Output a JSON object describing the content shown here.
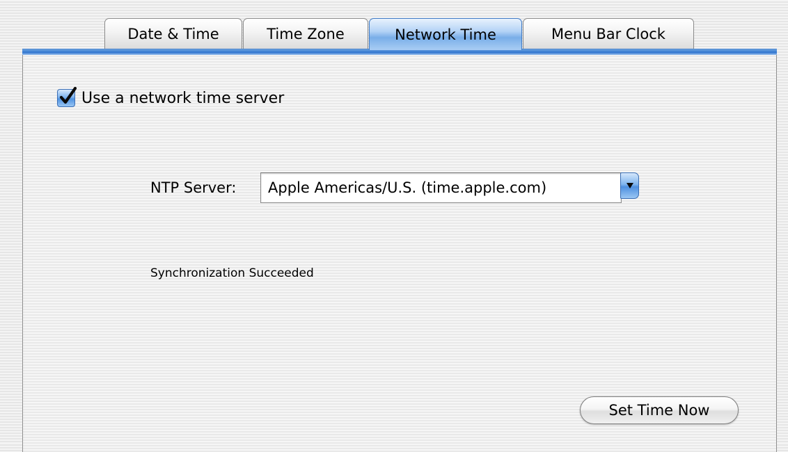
{
  "tabs": [
    {
      "label": "Date & Time",
      "active": false
    },
    {
      "label": "Time Zone",
      "active": false
    },
    {
      "label": "Network Time",
      "active": true
    },
    {
      "label": "Menu Bar Clock",
      "active": false
    }
  ],
  "network_time": {
    "use_server": {
      "label": "Use a network time server",
      "checked": true
    },
    "ntp_server": {
      "label": "NTP Server:",
      "value": "Apple Americas/U.S. (time.apple.com)"
    },
    "status": "Synchronization Succeeded",
    "set_time_button": "Set Time Now"
  },
  "colors": {
    "accent": "#4f92e1",
    "tab_active": "#79aee8",
    "background": "#ececec"
  },
  "icons": {
    "checkbox": "checkmark-icon",
    "dropdown": "chevron-down-icon"
  }
}
